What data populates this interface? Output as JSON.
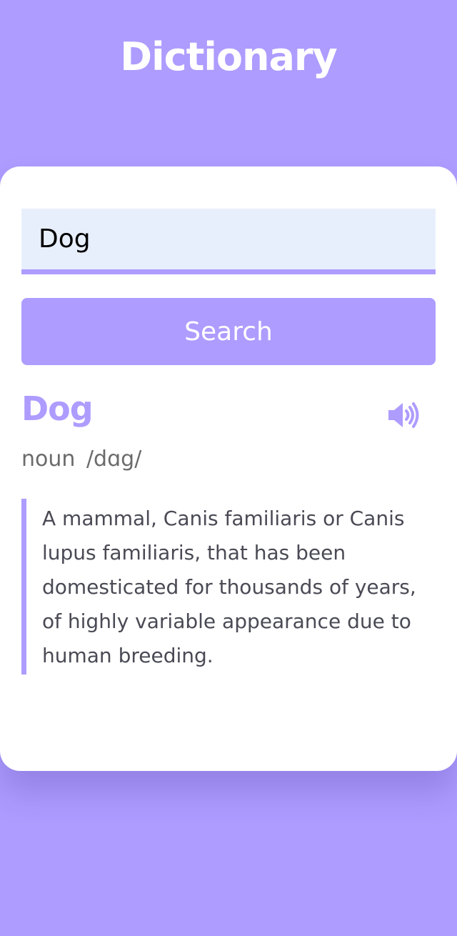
{
  "app": {
    "title": "Dictionary"
  },
  "search": {
    "value": "Dog",
    "placeholder": "",
    "button_label": "Search"
  },
  "result": {
    "word": "Dog",
    "part_of_speech": "noun",
    "phonetic": "/dɑg/",
    "definition": "A mammal, Canis familiaris or Canis lupus familiaris, that has been domesticated for thousands of years, of highly variable appearance due to human breeding.",
    "audio_icon": "volume-up-icon"
  },
  "colors": {
    "background": "#ae9cff",
    "accent": "#ae9cff",
    "card": "#ffffff",
    "input_background": "#e8effc",
    "text": "#4a4a55",
    "muted_text": "#6b6b6b"
  }
}
